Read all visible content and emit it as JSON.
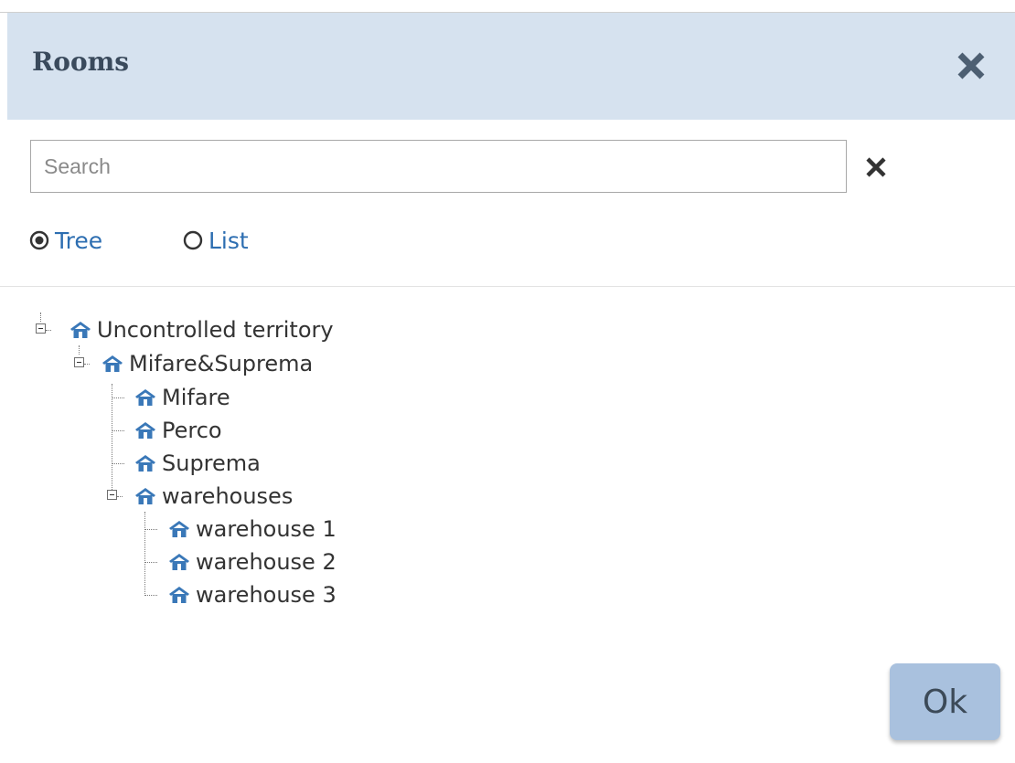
{
  "dialog": {
    "title": "Rooms"
  },
  "search": {
    "placeholder": "Search",
    "value": ""
  },
  "view_modes": [
    {
      "label": "Tree",
      "selected": true
    },
    {
      "label": "List",
      "selected": false
    }
  ],
  "tree": {
    "root": {
      "label": "Uncontrolled territory",
      "expanded": true
    },
    "mifare_suprema": {
      "label": "Mifare&Suprema",
      "expanded": true
    },
    "mifare": {
      "label": "Mifare"
    },
    "perco": {
      "label": "Perco"
    },
    "suprema": {
      "label": "Suprema"
    },
    "warehouses": {
      "label": "warehouses",
      "expanded": true
    },
    "warehouse1": {
      "label": "warehouse 1"
    },
    "warehouse2": {
      "label": "warehouse 2"
    },
    "warehouse3": {
      "label": "warehouse 3"
    }
  },
  "footer": {
    "ok_label": "Ok"
  },
  "colors": {
    "header_bg": "#d6e2ef",
    "accent": "#2d6eb1",
    "icon": "#3a78b8",
    "ok_bg": "#a9c1de"
  },
  "icons": {
    "close": "close-icon",
    "clear": "clear-icon",
    "room": "room-icon"
  }
}
